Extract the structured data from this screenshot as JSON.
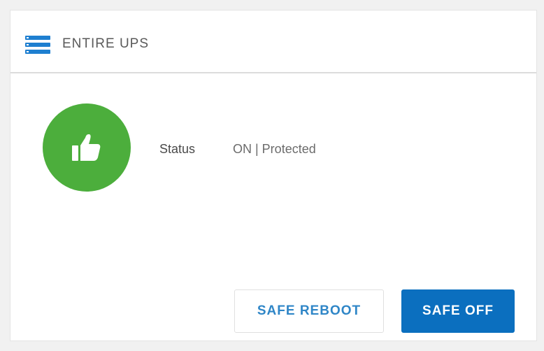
{
  "header": {
    "title": "ENTIRE UPS",
    "icon": "server-stack-icon"
  },
  "status": {
    "icon": "thumbs-up-icon",
    "label": "Status",
    "value": "ON | Protected",
    "color": "#4cae3c"
  },
  "actions": {
    "safe_reboot_label": "SAFE REBOOT",
    "safe_off_label": "SAFE OFF"
  },
  "colors": {
    "accent": "#0b6fbf",
    "link": "#2f86c7",
    "status_ok": "#4cae3c"
  }
}
